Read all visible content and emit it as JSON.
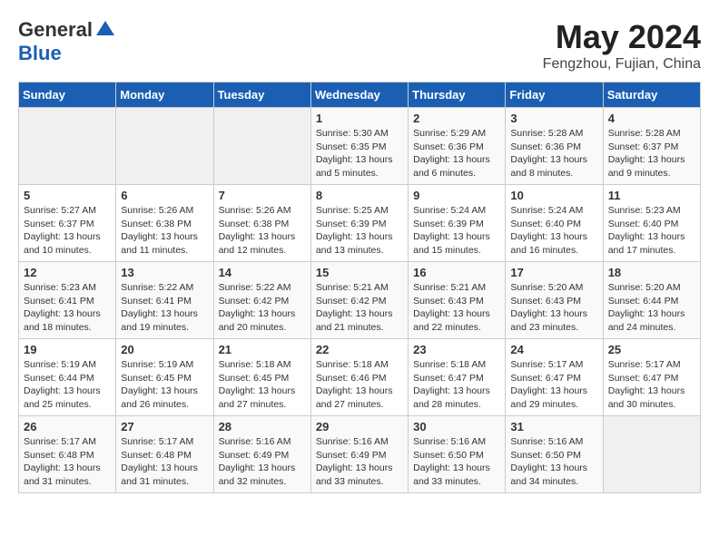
{
  "logo": {
    "general": "General",
    "blue": "Blue"
  },
  "header": {
    "month": "May 2024",
    "location": "Fengzhou, Fujian, China"
  },
  "days_of_week": [
    "Sunday",
    "Monday",
    "Tuesday",
    "Wednesday",
    "Thursday",
    "Friday",
    "Saturday"
  ],
  "weeks": [
    [
      {
        "day": "",
        "empty": true
      },
      {
        "day": "",
        "empty": true
      },
      {
        "day": "",
        "empty": true
      },
      {
        "day": "1",
        "sunrise": "5:30 AM",
        "sunset": "6:35 PM",
        "daylight": "13 hours and 5 minutes."
      },
      {
        "day": "2",
        "sunrise": "5:29 AM",
        "sunset": "6:36 PM",
        "daylight": "13 hours and 6 minutes."
      },
      {
        "day": "3",
        "sunrise": "5:28 AM",
        "sunset": "6:36 PM",
        "daylight": "13 hours and 8 minutes."
      },
      {
        "day": "4",
        "sunrise": "5:28 AM",
        "sunset": "6:37 PM",
        "daylight": "13 hours and 9 minutes."
      }
    ],
    [
      {
        "day": "5",
        "sunrise": "5:27 AM",
        "sunset": "6:37 PM",
        "daylight": "13 hours and 10 minutes."
      },
      {
        "day": "6",
        "sunrise": "5:26 AM",
        "sunset": "6:38 PM",
        "daylight": "13 hours and 11 minutes."
      },
      {
        "day": "7",
        "sunrise": "5:26 AM",
        "sunset": "6:38 PM",
        "daylight": "13 hours and 12 minutes."
      },
      {
        "day": "8",
        "sunrise": "5:25 AM",
        "sunset": "6:39 PM",
        "daylight": "13 hours and 13 minutes."
      },
      {
        "day": "9",
        "sunrise": "5:24 AM",
        "sunset": "6:39 PM",
        "daylight": "13 hours and 15 minutes."
      },
      {
        "day": "10",
        "sunrise": "5:24 AM",
        "sunset": "6:40 PM",
        "daylight": "13 hours and 16 minutes."
      },
      {
        "day": "11",
        "sunrise": "5:23 AM",
        "sunset": "6:40 PM",
        "daylight": "13 hours and 17 minutes."
      }
    ],
    [
      {
        "day": "12",
        "sunrise": "5:23 AM",
        "sunset": "6:41 PM",
        "daylight": "13 hours and 18 minutes."
      },
      {
        "day": "13",
        "sunrise": "5:22 AM",
        "sunset": "6:41 PM",
        "daylight": "13 hours and 19 minutes."
      },
      {
        "day": "14",
        "sunrise": "5:22 AM",
        "sunset": "6:42 PM",
        "daylight": "13 hours and 20 minutes."
      },
      {
        "day": "15",
        "sunrise": "5:21 AM",
        "sunset": "6:42 PM",
        "daylight": "13 hours and 21 minutes."
      },
      {
        "day": "16",
        "sunrise": "5:21 AM",
        "sunset": "6:43 PM",
        "daylight": "13 hours and 22 minutes."
      },
      {
        "day": "17",
        "sunrise": "5:20 AM",
        "sunset": "6:43 PM",
        "daylight": "13 hours and 23 minutes."
      },
      {
        "day": "18",
        "sunrise": "5:20 AM",
        "sunset": "6:44 PM",
        "daylight": "13 hours and 24 minutes."
      }
    ],
    [
      {
        "day": "19",
        "sunrise": "5:19 AM",
        "sunset": "6:44 PM",
        "daylight": "13 hours and 25 minutes."
      },
      {
        "day": "20",
        "sunrise": "5:19 AM",
        "sunset": "6:45 PM",
        "daylight": "13 hours and 26 minutes."
      },
      {
        "day": "21",
        "sunrise": "5:18 AM",
        "sunset": "6:45 PM",
        "daylight": "13 hours and 27 minutes."
      },
      {
        "day": "22",
        "sunrise": "5:18 AM",
        "sunset": "6:46 PM",
        "daylight": "13 hours and 27 minutes."
      },
      {
        "day": "23",
        "sunrise": "5:18 AM",
        "sunset": "6:47 PM",
        "daylight": "13 hours and 28 minutes."
      },
      {
        "day": "24",
        "sunrise": "5:17 AM",
        "sunset": "6:47 PM",
        "daylight": "13 hours and 29 minutes."
      },
      {
        "day": "25",
        "sunrise": "5:17 AM",
        "sunset": "6:47 PM",
        "daylight": "13 hours and 30 minutes."
      }
    ],
    [
      {
        "day": "26",
        "sunrise": "5:17 AM",
        "sunset": "6:48 PM",
        "daylight": "13 hours and 31 minutes."
      },
      {
        "day": "27",
        "sunrise": "5:17 AM",
        "sunset": "6:48 PM",
        "daylight": "13 hours and 31 minutes."
      },
      {
        "day": "28",
        "sunrise": "5:16 AM",
        "sunset": "6:49 PM",
        "daylight": "13 hours and 32 minutes."
      },
      {
        "day": "29",
        "sunrise": "5:16 AM",
        "sunset": "6:49 PM",
        "daylight": "13 hours and 33 minutes."
      },
      {
        "day": "30",
        "sunrise": "5:16 AM",
        "sunset": "6:50 PM",
        "daylight": "13 hours and 33 minutes."
      },
      {
        "day": "31",
        "sunrise": "5:16 AM",
        "sunset": "6:50 PM",
        "daylight": "13 hours and 34 minutes."
      },
      {
        "day": "",
        "empty": true
      }
    ]
  ]
}
